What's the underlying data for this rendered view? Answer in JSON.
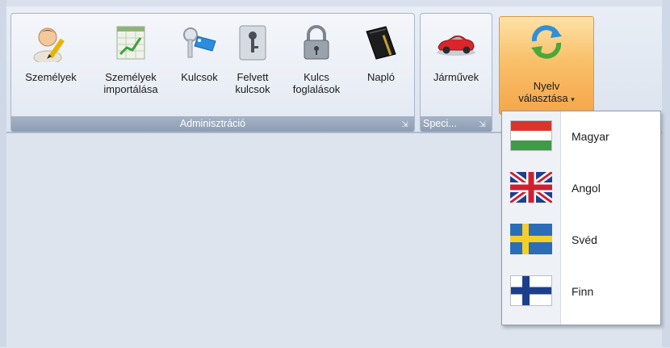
{
  "ribbon": {
    "groups": [
      {
        "title": "Adminisztráció",
        "launcher_icon": "dialog-launcher-icon",
        "buttons": [
          {
            "line1": "Személyek",
            "line2": "",
            "icon": "user-pencil-icon"
          },
          {
            "line1": "Személyek",
            "line2": "importálása",
            "icon": "import-chart-icon"
          },
          {
            "line1": "Kulcsok",
            "line2": "",
            "icon": "key-tag-icon"
          },
          {
            "line1": "Felvett",
            "line2": "kulcsok",
            "icon": "key-cabinet-icon"
          },
          {
            "line1": "Kulcs",
            "line2": "foglalások",
            "icon": "padlock-icon"
          },
          {
            "line1": "Napló",
            "line2": "",
            "icon": "log-book-icon"
          }
        ]
      },
      {
        "title": "Speci...",
        "launcher_icon": "dialog-launcher-icon",
        "buttons": [
          {
            "line1": "Járművek",
            "line2": "",
            "icon": "car-icon"
          }
        ]
      }
    ],
    "language_button": {
      "line1": "Nyelv",
      "line2": "választása",
      "caret": "▾",
      "icon": "refresh-arrows-icon",
      "active": true
    }
  },
  "language_menu": {
    "items": [
      {
        "label": "Magyar",
        "flag": "hungary-flag-icon"
      },
      {
        "label": "Angol",
        "flag": "uk-flag-icon"
      },
      {
        "label": "Svéd",
        "flag": "sweden-flag-icon"
      },
      {
        "label": "Finn",
        "flag": "finland-flag-icon"
      }
    ]
  },
  "colors": {
    "accent_active": "#f9c06a",
    "group_title": "#8d9db3",
    "workspace": "#dde4ee"
  }
}
